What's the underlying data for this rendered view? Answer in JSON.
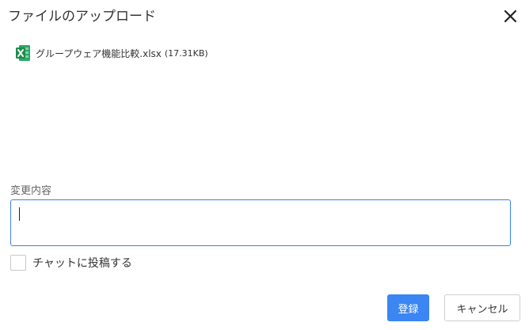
{
  "dialog": {
    "title": "ファイルのアップロード",
    "close_icon": "close-icon"
  },
  "file": {
    "icon": "excel-file-icon",
    "name": "グループウェア機能比較.xlsx",
    "size": "(17.31KB)",
    "icon_color": "#1f8b4c"
  },
  "comment": {
    "label": "変更内容",
    "value": "",
    "placeholder": ""
  },
  "chat_post": {
    "label": "チャットに投稿する",
    "checked": false
  },
  "buttons": {
    "submit_label": "登録",
    "cancel_label": "キャンセル"
  },
  "colors": {
    "accent": "#3b86f2",
    "input_focus_border": "#3b82e6",
    "excel_green": "#1f8b4c"
  }
}
